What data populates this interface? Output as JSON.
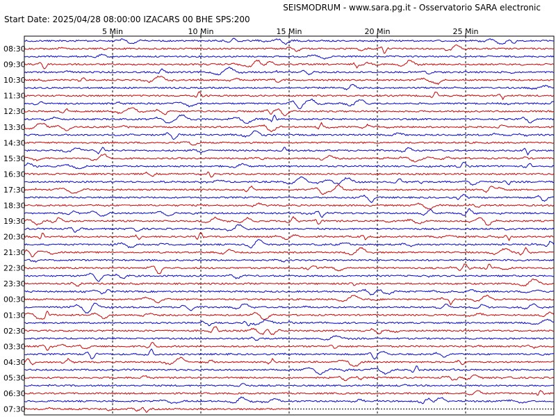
{
  "header": {
    "title": "SEISMODRUM - www.sara.pg.it - Osservatorio SARA electronic",
    "start_info": "Start Date: 2025/04/28 08:00:00 IZACARS 00 BHE  SPS:200"
  },
  "chart_data": {
    "type": "line",
    "title": "SEISMODRUM - www.sara.pg.it - Osservatorio SARA electronic",
    "subtitle": "Start Date: 2025/04/28 08:00:00 IZACARS 00 BHE  SPS:200",
    "x_ticks": [
      "5 Min",
      "10 Min",
      "15 Min",
      "20 Min",
      "25 Min"
    ],
    "x_tick_minutes": [
      5,
      10,
      15,
      20,
      25
    ],
    "x_range_minutes": [
      0,
      30
    ],
    "traces_per_hour": 2,
    "trace_count": 48,
    "colors": {
      "trace_a": "#cc0000",
      "trace_b": "#0000cc",
      "grid": "#000000",
      "frame": "#000000"
    },
    "row_labels": [
      "08:30",
      "09:30",
      "10:30",
      "11:30",
      "12:30",
      "13:30",
      "14:30",
      "15:30",
      "16:30",
      "17:30",
      "18:30",
      "19:30",
      "20:30",
      "21:30",
      "22:30",
      "23:30",
      "00:30",
      "01:30",
      "02:30",
      "03:30",
      "04:30",
      "05:30",
      "06:30",
      "07:30"
    ],
    "row_label_trace_index": [
      1,
      3,
      5,
      7,
      9,
      11,
      13,
      15,
      17,
      19,
      21,
      23,
      25,
      27,
      29,
      31,
      33,
      35,
      37,
      39,
      41,
      43,
      45,
      47
    ],
    "last_trace_end_minute": 15.0
  }
}
